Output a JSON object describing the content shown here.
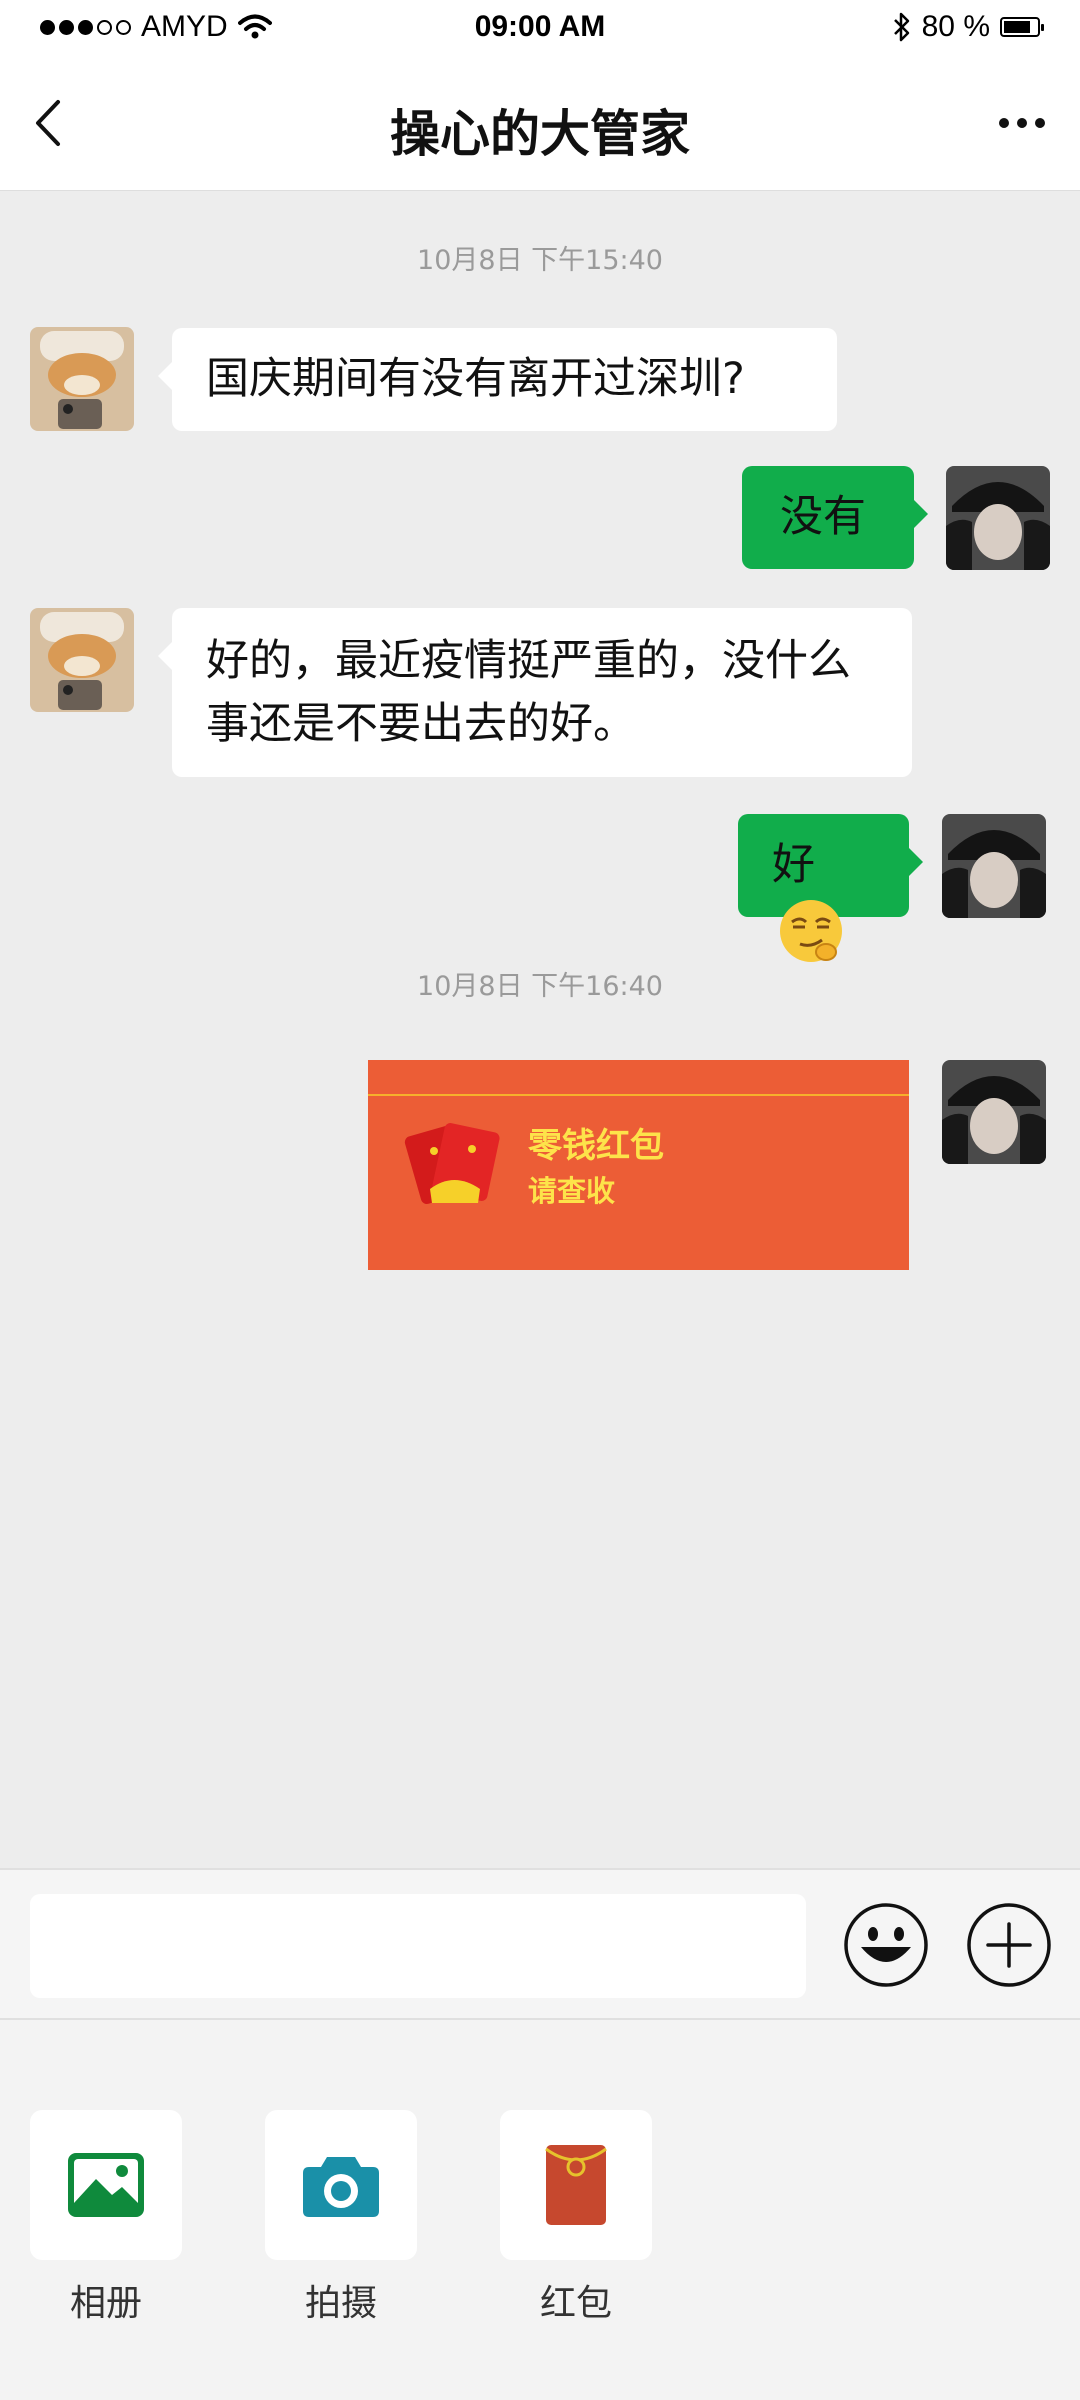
{
  "status_bar": {
    "carrier": "AMYD",
    "time": "09:00 AM",
    "battery_text": "80 %",
    "battery_level": 0.8
  },
  "nav": {
    "title": "操心的大管家"
  },
  "messages": [
    {
      "type": "timestamp",
      "text": "10月8日 下午15:40"
    },
    {
      "side": "left",
      "text": "国庆期间有没有离开过深圳?"
    },
    {
      "side": "right",
      "text": "没有"
    },
    {
      "side": "left",
      "text": "好的，最近疫情挺严重的，没什么事还是不要出去的好。"
    },
    {
      "side": "right",
      "text": "好",
      "emoji": "smirk-face-emoji"
    },
    {
      "type": "timestamp",
      "text": "10月8日 下午16:40"
    },
    {
      "side": "right",
      "type": "red_packet",
      "title": "零钱红包",
      "subtitle": "请查收"
    }
  ],
  "input": {
    "value": "",
    "placeholder": ""
  },
  "panel": {
    "tools": [
      {
        "label": "相册",
        "icon": "photo-album-icon"
      },
      {
        "label": "拍摄",
        "icon": "camera-icon"
      },
      {
        "label": "红包",
        "icon": "red-packet-icon"
      }
    ]
  },
  "colors": {
    "chat_background": "#ededed",
    "bubble_self": "#11ad4b",
    "bubble_other": "#ffffff",
    "red_packet": "#ec5d36",
    "red_packet_text": "#fde34a"
  }
}
